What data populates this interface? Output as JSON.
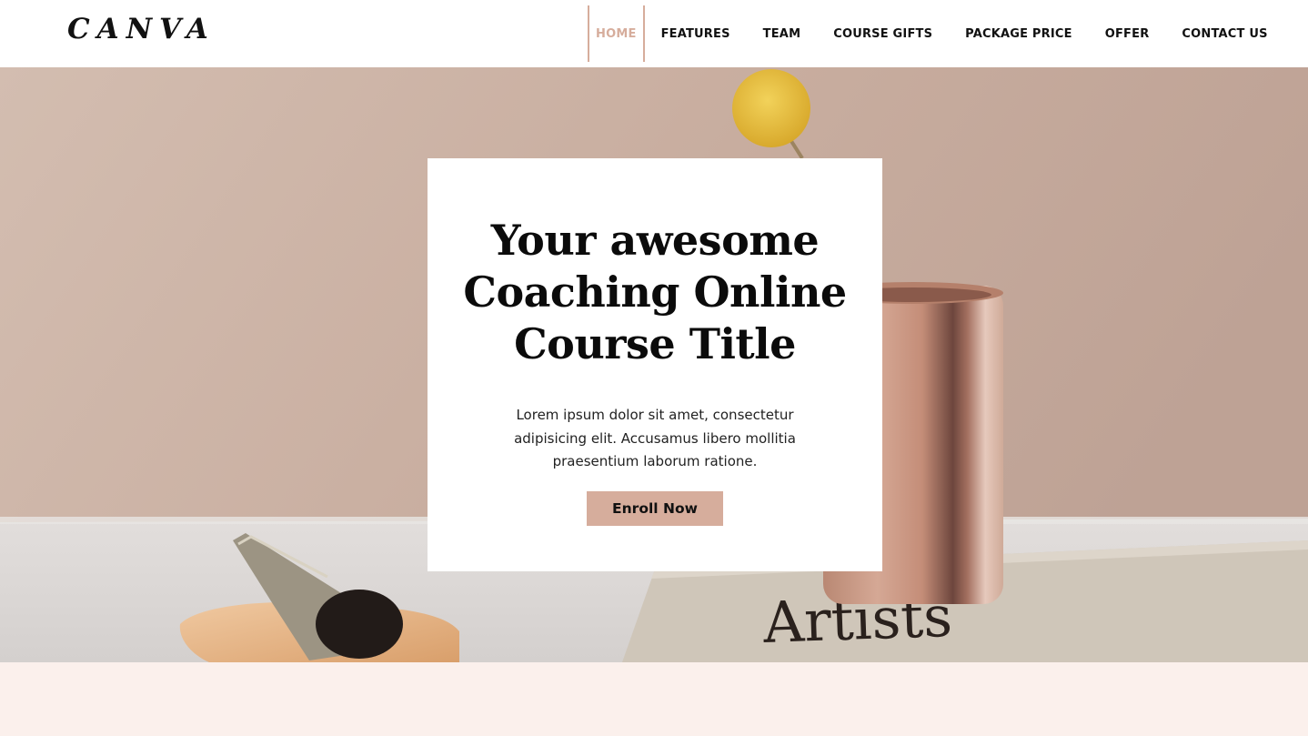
{
  "header": {
    "logo": "CANVA",
    "nav": [
      {
        "label": "HOME"
      },
      {
        "label": "FEATURES"
      },
      {
        "label": "TEAM"
      },
      {
        "label": "COURSE GIFTS"
      },
      {
        "label": "PACKAGE PRICE"
      },
      {
        "label": "OFFER"
      },
      {
        "label": "CONTACT US"
      }
    ],
    "active_nav": "HOME"
  },
  "hero": {
    "title_line1": "Your awesome",
    "title_line2": "Coaching Online",
    "title_line3": "Course Title",
    "description": "Lorem ipsum dolor sit amet, consectetur adipisicing elit. Accusamus libero mollitia praesentium laborum ratione.",
    "cta_label": "Enroll Now",
    "book_text": "Artists"
  },
  "colors": {
    "accent": "#d6ad9c",
    "header_bg": "#ffffff",
    "hero_wall": "#c9b0a2",
    "band_bg": "#fbf0ec"
  }
}
